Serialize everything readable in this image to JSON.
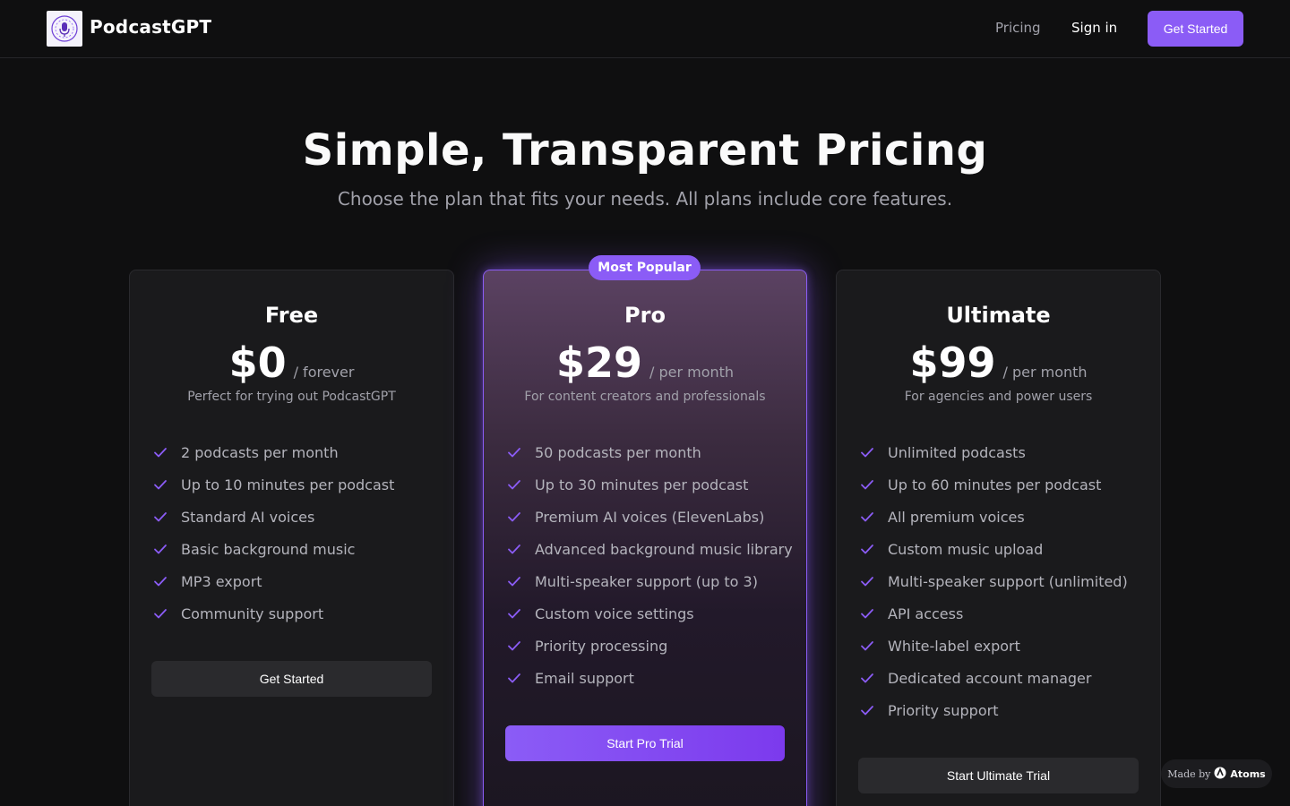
{
  "header": {
    "brand": "PodcastGPT",
    "nav_pricing": "Pricing",
    "nav_signin": "Sign in",
    "cta": "Get Started"
  },
  "hero": {
    "title": "Simple, Transparent Pricing",
    "subtitle": "Choose the plan that fits your needs. All plans include core features."
  },
  "plans": [
    {
      "name": "Free",
      "price": "$0",
      "period": "/ forever",
      "description": "Perfect for trying out PodcastGPT",
      "features": [
        "2 podcasts per month",
        "Up to 10 minutes per podcast",
        "Standard AI voices",
        "Basic background music",
        "MP3 export",
        "Community support"
      ],
      "button": "Get Started"
    },
    {
      "name": "Pro",
      "badge": "Most Popular",
      "price": "$29",
      "period": "/ per month",
      "description": "For content creators and professionals",
      "features": [
        "50 podcasts per month",
        "Up to 30 minutes per podcast",
        "Premium AI voices (ElevenLabs)",
        "Advanced background music library",
        "Multi-speaker support (up to 3)",
        "Custom voice settings",
        "Priority processing",
        "Email support"
      ],
      "button": "Start Pro Trial"
    },
    {
      "name": "Ultimate",
      "price": "$99",
      "period": "/ per month",
      "description": "For agencies and power users",
      "features": [
        "Unlimited podcasts",
        "Up to 60 minutes per podcast",
        "All premium voices",
        "Custom music upload",
        "Multi-speaker support (unlimited)",
        "API access",
        "White-label export",
        "Dedicated account manager",
        "Priority support"
      ],
      "button": "Start Ultimate Trial"
    }
  ],
  "made_by": {
    "prefix": "Made by",
    "brand": "Atoms"
  },
  "colors": {
    "accent": "#8b5cf6",
    "background": "#0f0f10",
    "card": "#1a1a1c",
    "check": "#8b5cf6"
  },
  "icons": {
    "logo": "microphone-logo-icon",
    "check": "check-icon",
    "made_by": "atoms-logo-icon"
  }
}
